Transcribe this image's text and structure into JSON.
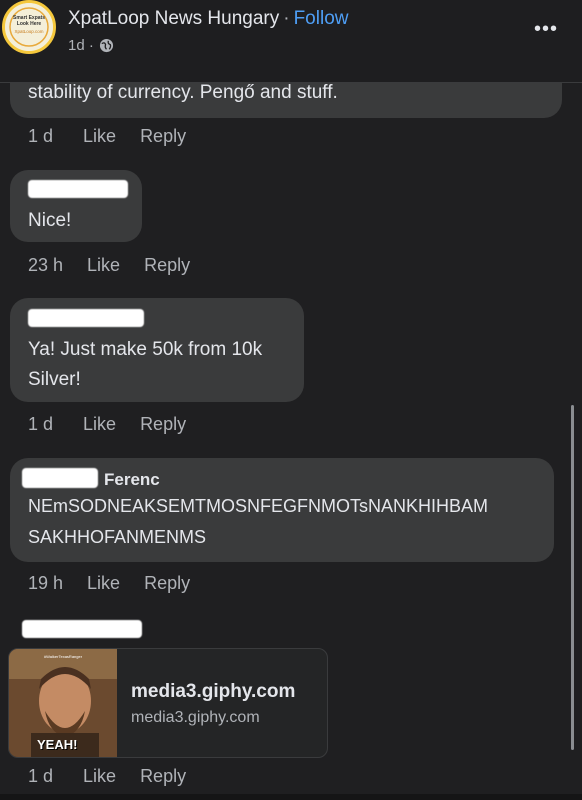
{
  "header": {
    "page_name": "XpatLoop News Hungary",
    "separator": "·",
    "follow_label": "Follow",
    "post_time": "1d ·",
    "privacy_icon": "globe-icon",
    "more_icon": "more-dots-icon",
    "more_label": "•••",
    "avatar_text": [
      "Smart Expats",
      "Look Here",
      "XpatLoop.com"
    ]
  },
  "comments": [
    {
      "text": "stability of currency. Pengő and stuff.",
      "time": "1 d",
      "like": "Like",
      "reply": "Reply"
    },
    {
      "text": "Nice!",
      "time": "23 h",
      "like": "Like",
      "reply": "Reply"
    },
    {
      "lines": [
        "Ya! Just make 50k from 10k",
        "Silver!"
      ],
      "time": "1 d",
      "like": "Like",
      "reply": "Reply"
    },
    {
      "author_visible": "Ferenc",
      "lines": [
        "NEmSODNEAKSEMTMOSNFEGFNMOTsNANKHIHBAM",
        "SAKHHOFANMENMS"
      ],
      "time": "19 h",
      "like": "Like",
      "reply": "Reply"
    },
    {
      "link_card": {
        "title": "media3.giphy.com",
        "subtitle": "media3.giphy.com",
        "gif_caption": "YEAH!",
        "gif_tag": "#WalkerTexasRanger"
      },
      "time": "1 d",
      "like": "Like",
      "reply": "Reply"
    }
  ],
  "colors": {
    "background": "#1f1f21",
    "bubble": "#3a3b3c",
    "follow": "#4e9ef5",
    "meta_text": "#b0b3b8"
  }
}
